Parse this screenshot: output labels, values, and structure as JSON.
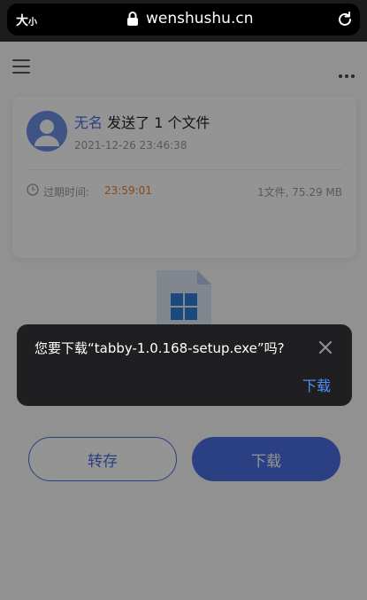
{
  "browser": {
    "text_size_big": "大",
    "text_size_small": "小",
    "domain": "wenshushu.cn"
  },
  "share": {
    "sender_name": "无名",
    "sent_text": "发送了 1 个文件",
    "sent_time": "2021-12-26 23:46:38",
    "expire_label": "过期时间:",
    "expire_value": "23:59:01",
    "file_meta": "1文件, 75.29 MB"
  },
  "actions": {
    "save_label": "转存",
    "download_label": "下载"
  },
  "dialog": {
    "message": "您要下载“tabby-1.0.168-setup.exe”吗?",
    "download_label": "下载"
  },
  "colors": {
    "accent": "#4a6ee0",
    "expire": "#f07a2b",
    "dialog_link": "#4d8ef7"
  }
}
